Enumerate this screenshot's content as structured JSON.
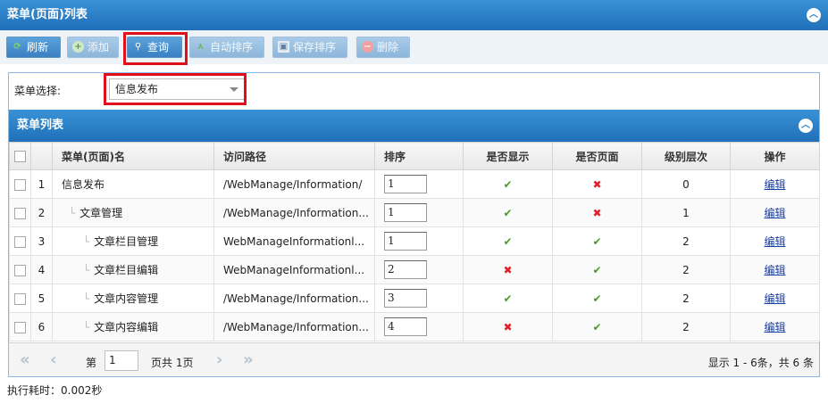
{
  "window": {
    "title": "菜单(页面)列表"
  },
  "toolbar": {
    "refresh": "刷新",
    "add": "添加",
    "query": "查询",
    "auto_sort": "自动排序",
    "save_sort": "保存排序",
    "delete": "删除"
  },
  "filter": {
    "label": "菜单选择:",
    "selected": "信息发布"
  },
  "list": {
    "title": "菜单列表",
    "columns": [
      "菜单(页面)名",
      "访问路径",
      "排序",
      "是否显示",
      "是否页面",
      "级别层次",
      "操作"
    ],
    "rows": [
      {
        "num": "1",
        "name": "信息发布",
        "tree": "",
        "path": "/WebManage/Information/",
        "order": "1",
        "show": "yes",
        "page": "no",
        "level": "0",
        "action": "编辑"
      },
      {
        "num": "2",
        "name": "文章管理",
        "tree": "└",
        "path": "/WebManage/Information...",
        "order": "1",
        "show": "yes",
        "page": "no",
        "level": "1",
        "action": "编辑"
      },
      {
        "num": "3",
        "name": "文章栏目管理",
        "tree": "└",
        "path": "WebManageInformationl...",
        "order": "1",
        "show": "yes",
        "page": "yes",
        "level": "2",
        "action": "编辑"
      },
      {
        "num": "4",
        "name": "文章栏目编辑",
        "tree": "└",
        "path": "WebManageInformationl...",
        "order": "2",
        "show": "no",
        "page": "yes",
        "level": "2",
        "action": "编辑"
      },
      {
        "num": "5",
        "name": "文章内容管理",
        "tree": "└",
        "path": "/WebManage/Information...",
        "order": "3",
        "show": "yes",
        "page": "yes",
        "level": "2",
        "action": "编辑"
      },
      {
        "num": "6",
        "name": "文章内容编辑",
        "tree": "└",
        "path": "/WebManage/Information...",
        "order": "4",
        "show": "no",
        "page": "yes",
        "level": "2",
        "action": "编辑"
      }
    ]
  },
  "pager": {
    "page_prefix": "第",
    "page_value": "1",
    "page_suffix": "页共 1页",
    "summary": "显示 1 - 6条，共 6 条"
  },
  "footer": {
    "exec_time": "执行耗时：0.002秒"
  },
  "colors": {
    "header_blue": "#1f70b8",
    "highlight_red": "#e0101a",
    "ok_green": "#4c9a2a",
    "no_red": "#e0202a"
  }
}
